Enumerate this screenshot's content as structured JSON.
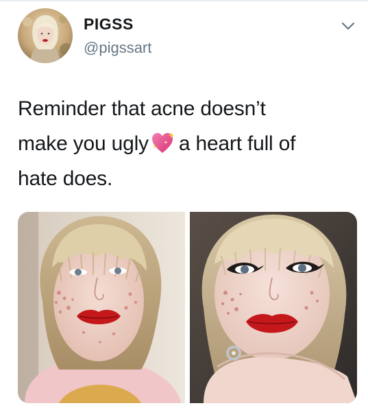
{
  "tweet": {
    "author": {
      "name": "PIGSS",
      "handle": "@pigssart",
      "avatar_icon": "user-avatar-photo"
    },
    "more_icon": "chevron-down-icon",
    "text": {
      "line1": "Reminder that acne doesn’t",
      "line2_before": "make you ugly",
      "line2_emoji": "sparkling-heart-emoji",
      "line2_after": "a heart full of",
      "line3": "hate does."
    },
    "media": [
      {
        "label": "photo-left",
        "description_icon": "face-photo-natural"
      },
      {
        "label": "photo-right",
        "description_icon": "face-photo-makeup"
      }
    ]
  },
  "colors": {
    "text": "#14171a",
    "secondary": "#657786",
    "lip_red": "#c4181b",
    "heart_pink": "#ea4d8c"
  }
}
